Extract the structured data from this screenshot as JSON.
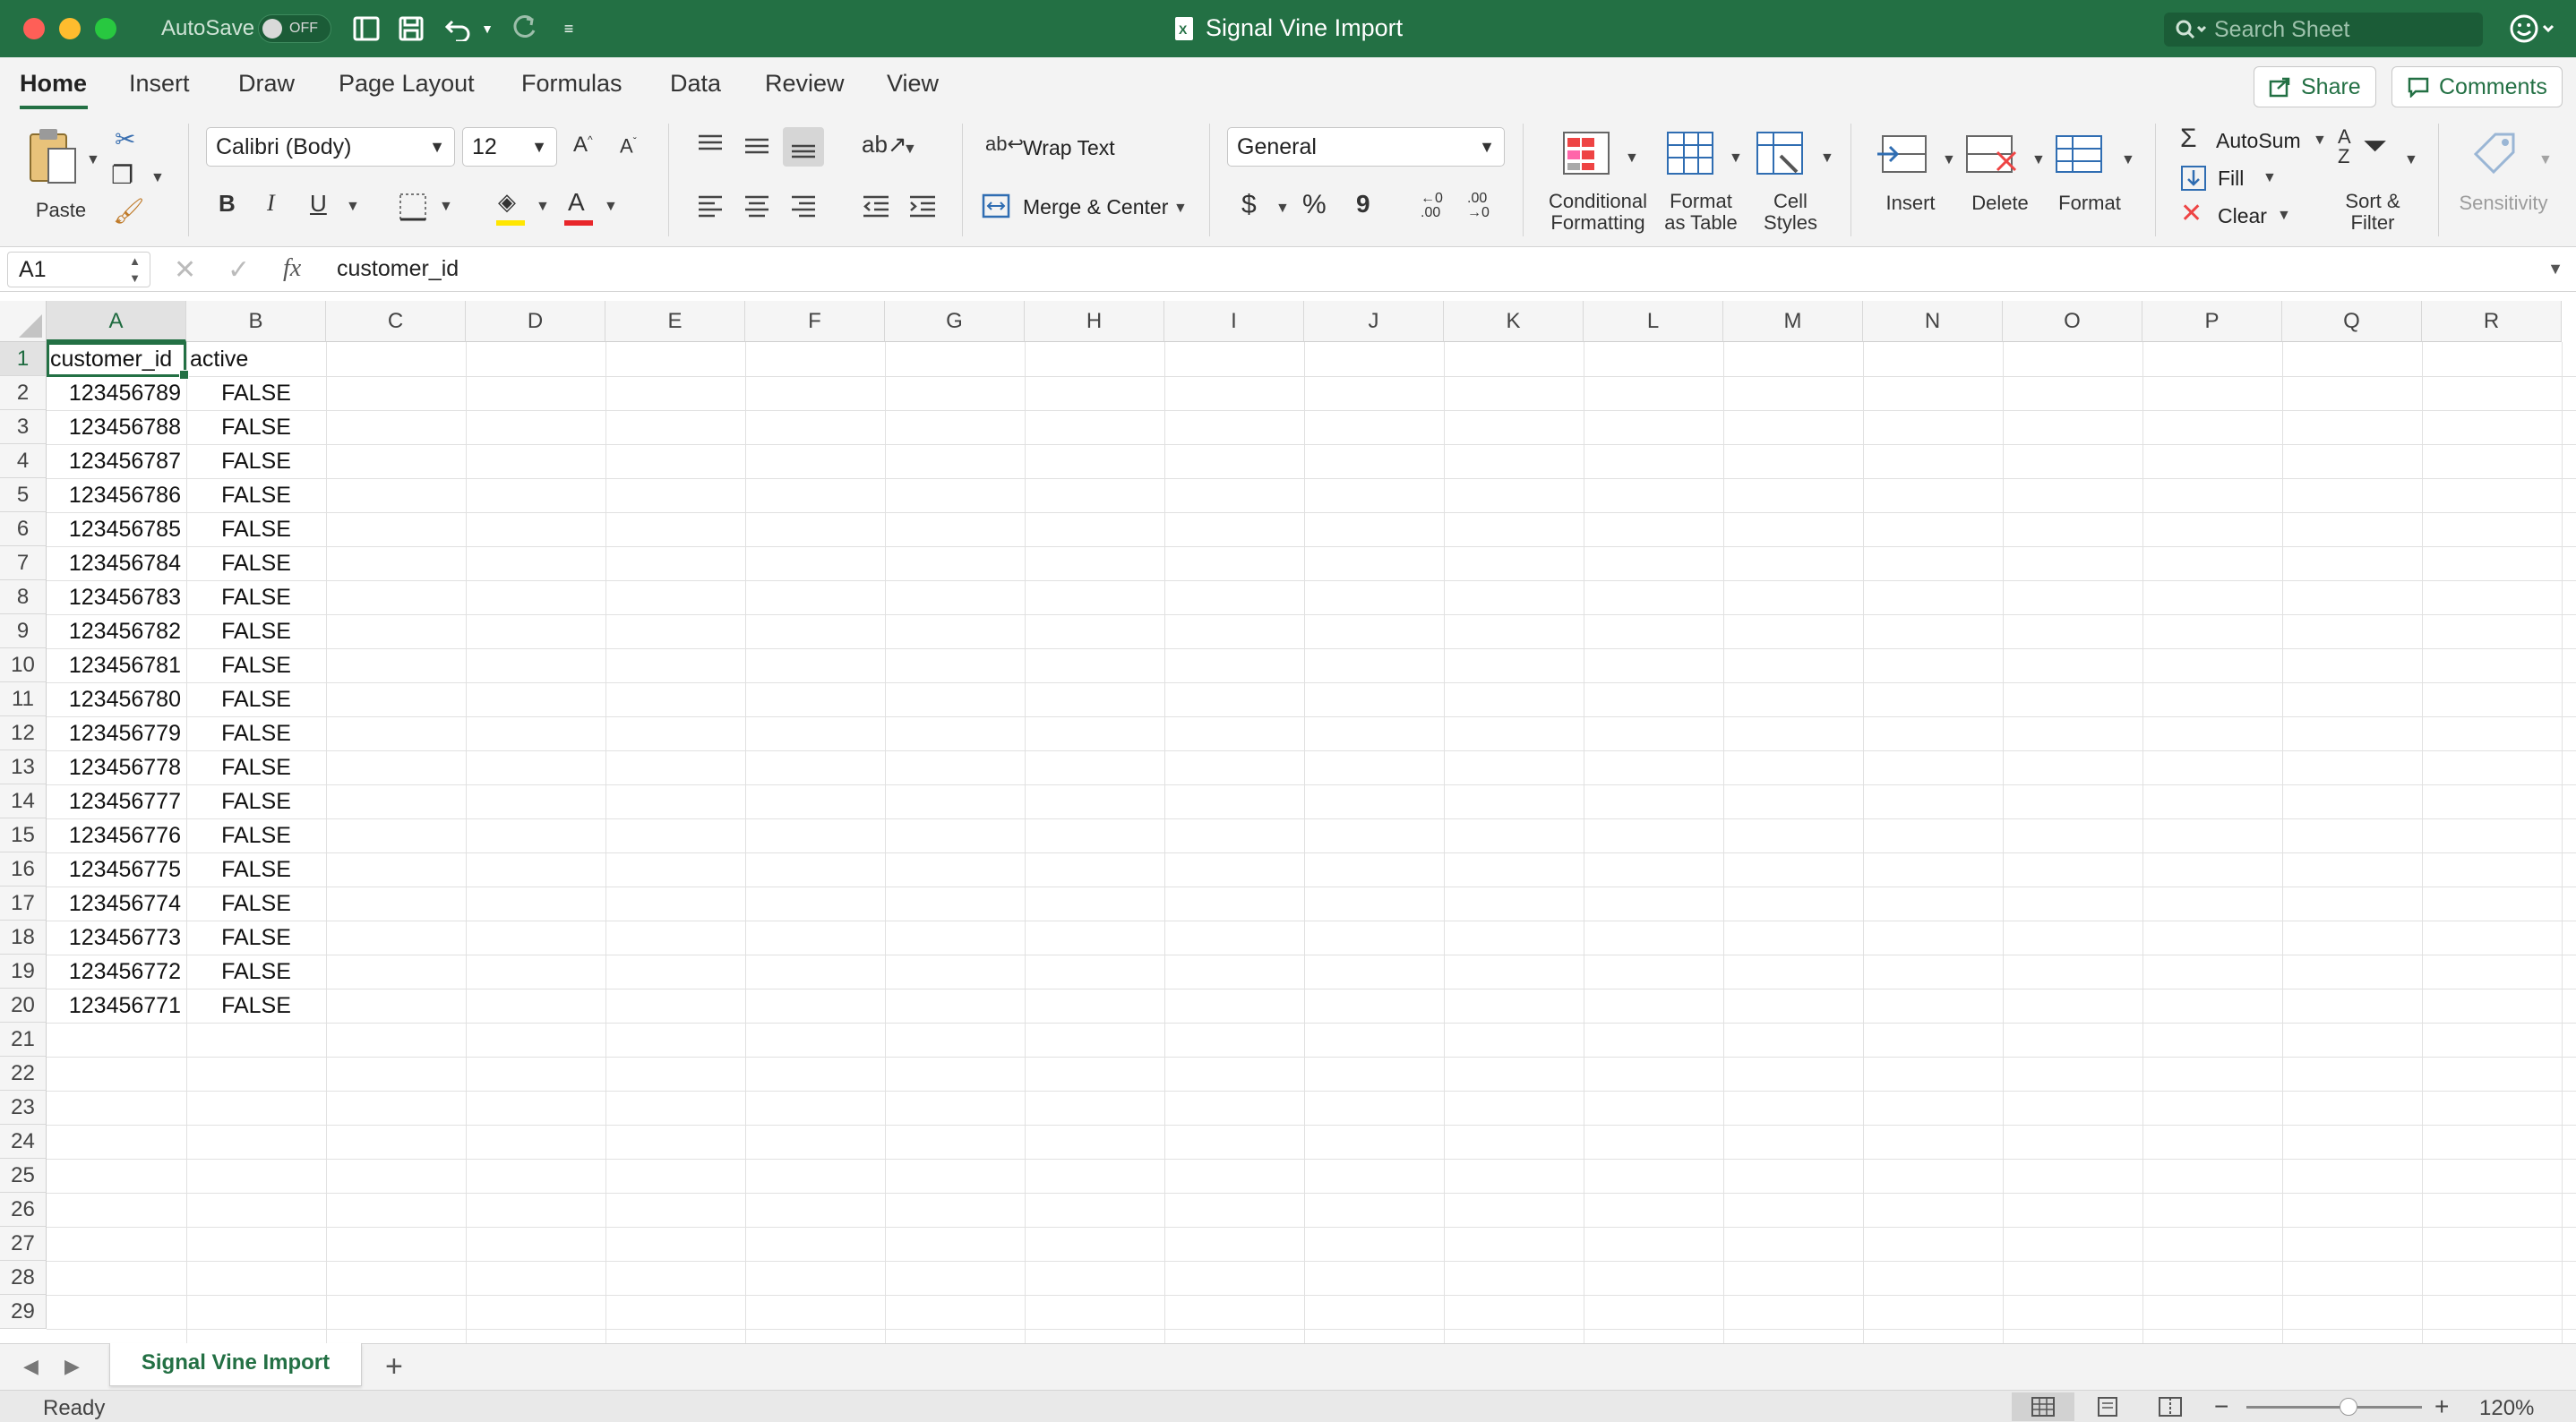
{
  "window": {
    "autosave_label": "AutoSave",
    "autosave_state": "OFF",
    "title": "Signal Vine Import",
    "search_placeholder": "Search Sheet"
  },
  "ribbon_tabs": [
    "Home",
    "Insert",
    "Draw",
    "Page Layout",
    "Formulas",
    "Data",
    "Review",
    "View"
  ],
  "share_label": "Share",
  "comments_label": "Comments",
  "ribbon": {
    "paste": "Paste",
    "font_name": "Calibri (Body)",
    "font_size": "12",
    "bold": "B",
    "italic": "I",
    "underline": "U",
    "wrap_text": "Wrap Text",
    "merge_center": "Merge & Center",
    "number_format": "General",
    "currency": "$",
    "percent": "%",
    "comma": "9",
    "conditional_formatting_1": "Conditional",
    "conditional_formatting_2": "Formatting",
    "format_as_table_1": "Format",
    "format_as_table_2": "as Table",
    "cell_styles_1": "Cell",
    "cell_styles_2": "Styles",
    "insert": "Insert",
    "delete": "Delete",
    "format": "Format",
    "autosum": "AutoSum",
    "fill": "Fill",
    "clear": "Clear",
    "sort_filter_1": "Sort &",
    "sort_filter_2": "Filter",
    "sensitivity": "Sensitivity"
  },
  "formula_bar": {
    "name_box": "A1",
    "fx": "fx",
    "content": "customer_id"
  },
  "columns": [
    "A",
    "B",
    "C",
    "D",
    "E",
    "F",
    "G",
    "H",
    "I",
    "J",
    "K",
    "L",
    "M",
    "N",
    "O",
    "P",
    "Q",
    "R"
  ],
  "rows": [
    "1",
    "2",
    "3",
    "4",
    "5",
    "6",
    "7",
    "8",
    "9",
    "10",
    "11",
    "12",
    "13",
    "14",
    "15",
    "16",
    "17",
    "18",
    "19",
    "20",
    "21",
    "22",
    "23",
    "24",
    "25",
    "26",
    "27",
    "28",
    "29"
  ],
  "table": {
    "headers": [
      "customer_id",
      "active"
    ],
    "data": [
      [
        "123456789",
        "FALSE"
      ],
      [
        "123456788",
        "FALSE"
      ],
      [
        "123456787",
        "FALSE"
      ],
      [
        "123456786",
        "FALSE"
      ],
      [
        "123456785",
        "FALSE"
      ],
      [
        "123456784",
        "FALSE"
      ],
      [
        "123456783",
        "FALSE"
      ],
      [
        "123456782",
        "FALSE"
      ],
      [
        "123456781",
        "FALSE"
      ],
      [
        "123456780",
        "FALSE"
      ],
      [
        "123456779",
        "FALSE"
      ],
      [
        "123456778",
        "FALSE"
      ],
      [
        "123456777",
        "FALSE"
      ],
      [
        "123456776",
        "FALSE"
      ],
      [
        "123456775",
        "FALSE"
      ],
      [
        "123456774",
        "FALSE"
      ],
      [
        "123456773",
        "FALSE"
      ],
      [
        "123456772",
        "FALSE"
      ],
      [
        "123456771",
        "FALSE"
      ]
    ]
  },
  "sheets": [
    "Signal Vine Import"
  ],
  "add_sheet": "+",
  "status": {
    "text": "Ready",
    "zoom": "120%",
    "zoom_level_fraction": 0.58
  },
  "colors": {
    "accent": "#237044",
    "highlight_yellow": "#ffe600",
    "font_red": "#e8262a"
  }
}
